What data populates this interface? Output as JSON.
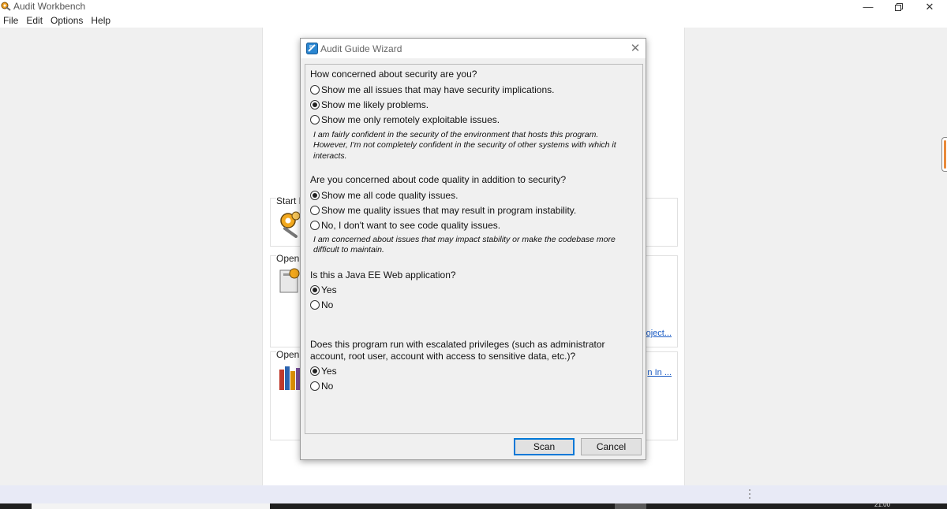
{
  "window": {
    "title": "Audit Workbench"
  },
  "menu": [
    "File",
    "Edit",
    "Options",
    "Help"
  ],
  "background": {
    "sections": [
      {
        "label": "Start N",
        "link": ""
      },
      {
        "label": "Open",
        "link": "oject..."
      },
      {
        "label": "Open",
        "link": "n In ..."
      }
    ]
  },
  "taskbar": {
    "clock": "21:00"
  },
  "dialog": {
    "title": "Audit Guide Wizard",
    "questions": [
      {
        "text": "How concerned about security are you?",
        "options": [
          {
            "label": "Show me all issues that may have security implications.",
            "selected": false
          },
          {
            "label": "Show me likely problems.",
            "selected": true
          },
          {
            "label": "Show me only remotely exploitable issues.",
            "selected": false
          }
        ],
        "description": "I am fairly confident in the security of the environment that hosts this program. However, I'm not completely confident in the security of other systems with which it interacts."
      },
      {
        "text": "Are you concerned about code quality in addition to security?",
        "options": [
          {
            "label": "Show me all code quality issues.",
            "selected": true
          },
          {
            "label": "Show me quality issues that may result in program instability.",
            "selected": false
          },
          {
            "label": "No, I don't want to see code quality issues.",
            "selected": false
          }
        ],
        "description": "I am concerned about issues that may impact stability or make the codebase more difficult to maintain."
      },
      {
        "text": "Is this a Java EE Web application?",
        "options": [
          {
            "label": "Yes",
            "selected": true
          },
          {
            "label": "No",
            "selected": false
          }
        ]
      },
      {
        "text": "Does this program run with escalated privileges (such as administrator account, root user, account with access to sensitive data, etc.)?",
        "options": [
          {
            "label": "Yes",
            "selected": true
          },
          {
            "label": "No",
            "selected": false
          }
        ]
      }
    ],
    "buttons": {
      "scan": "Scan",
      "cancel": "Cancel"
    }
  }
}
